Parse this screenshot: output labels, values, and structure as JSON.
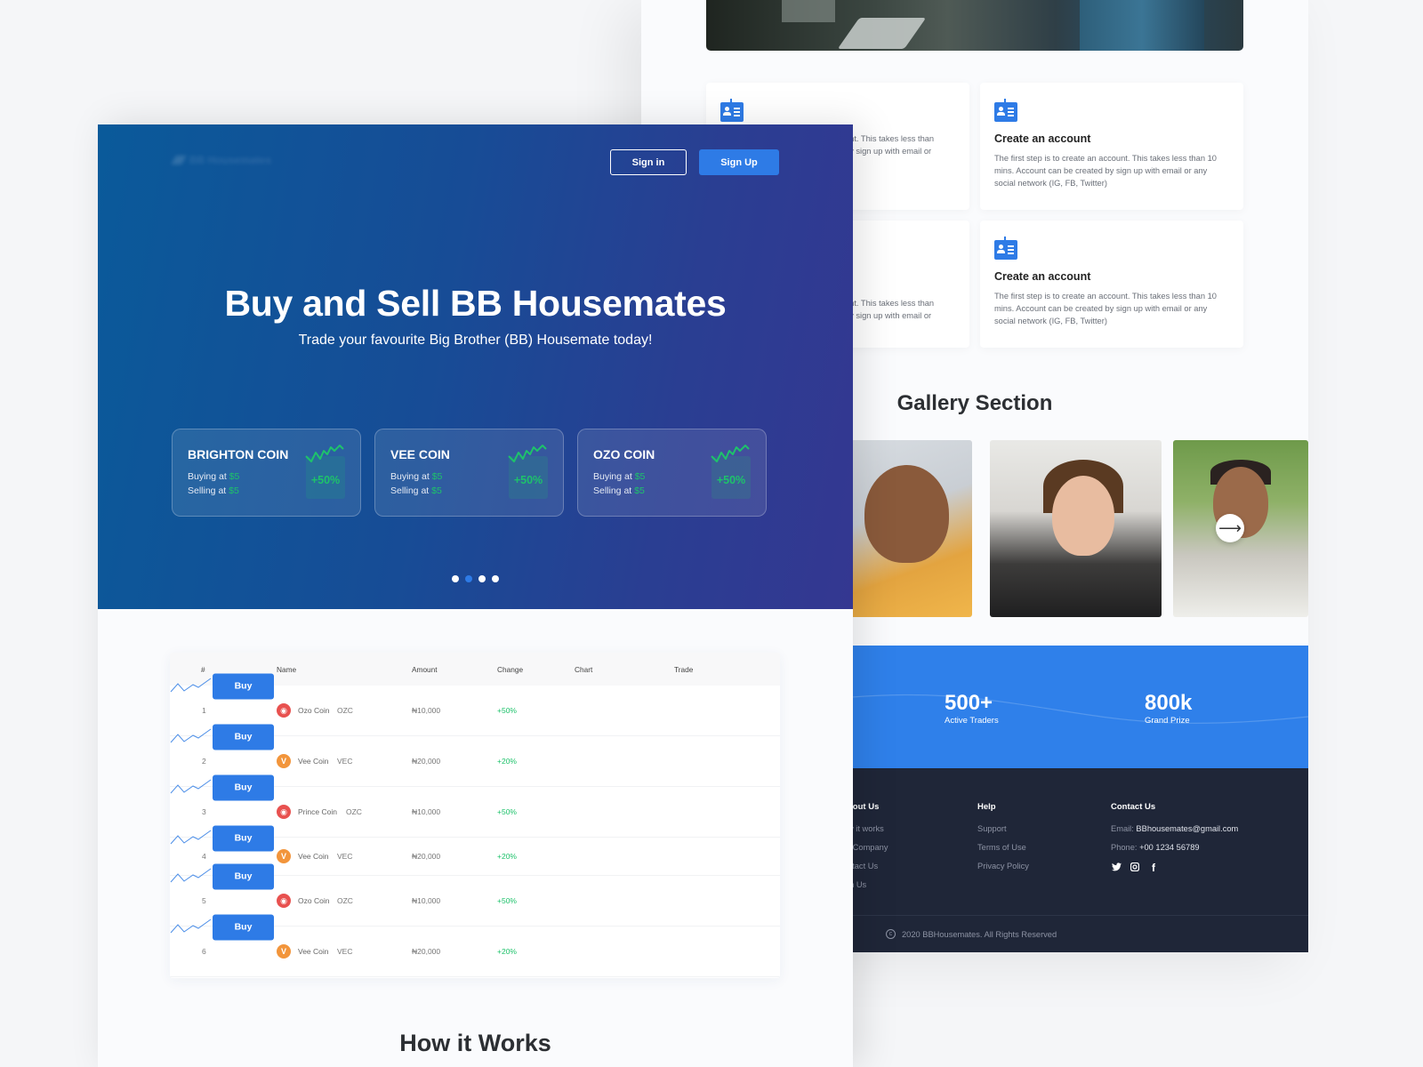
{
  "back_page": {
    "steps": [
      {
        "title": "",
        "text": "unt. This takes less than\nby sign up with email or\n)"
      },
      {
        "title": "Create an account",
        "text": "The first step is to create an account. This takes less than 10 mins. Account can be created by sign up with email or any social network (IG, FB, Twitter)"
      },
      {
        "title": "",
        "text": "unt. This takes less than\nby sign up with email or\n)"
      },
      {
        "title": "Create an account",
        "text": "The first step is to create an account. This takes less than 10 mins. Account can be created by sign up with email or any social network (IG, FB, Twitter)"
      }
    ],
    "gallery": {
      "title": "Gallery Section",
      "next_icon": "arrow-right-icon",
      "next_glyph": "⟶"
    },
    "stats": [
      {
        "value": "500+",
        "label": "Active Traders"
      },
      {
        "value": "800k",
        "label": "Grand Prize"
      }
    ],
    "footer": {
      "about": {
        "heading": "bout Us",
        "links": [
          "w it works",
          "r Company",
          "ntact Us",
          "in Us"
        ]
      },
      "help": {
        "heading": "Help",
        "links": [
          "Support",
          "Terms of Use",
          "Privacy Policy"
        ]
      },
      "contact": {
        "heading": "Contact Us",
        "email_label": "Email: ",
        "email": "BBhousemates@gmail.com",
        "phone_label": "Phone: ",
        "phone": "+00 1234 56789",
        "socials": [
          {
            "name": "twitter-icon",
            "glyph": "🐦︎"
          },
          {
            "name": "instagram-icon",
            "glyph": "◎"
          },
          {
            "name": "facebook-icon",
            "glyph": "f"
          }
        ]
      },
      "copyright_glyph": "c",
      "copyright": "2020 BBHousemates. All Rights Reserved"
    }
  },
  "front_page": {
    "logo": "BB Housemates",
    "nav": {
      "sign_in": "Sign in",
      "sign_up": "Sign Up"
    },
    "hero": {
      "title": "Buy and Sell BB Housemates",
      "subtitle": "Trade your favourite Big Brother (BB) Housemate today!"
    },
    "coins": [
      {
        "name": "BRIGHTON COIN",
        "buy_label": "Buying at ",
        "buy_price": "$5",
        "sell_label": "Selling at ",
        "sell_price": "$5",
        "change": "+50%"
      },
      {
        "name": "VEE COIN",
        "buy_label": "Buying at ",
        "buy_price": "$5",
        "sell_label": "Selling at ",
        "sell_price": "$5",
        "change": "+50%"
      },
      {
        "name": "OZO COIN",
        "buy_label": "Buying at ",
        "buy_price": "$5",
        "sell_label": "Selling at ",
        "sell_price": "$5",
        "change": "+50%"
      }
    ],
    "carousel": {
      "count": 4,
      "active_index": 1
    },
    "table": {
      "headers": [
        "#",
        "Name",
        "Amount",
        "Change",
        "Chart",
        "Trade"
      ],
      "rows": [
        {
          "num": "1",
          "icon": "red",
          "glyph": "◉",
          "name": "Ozo Coin",
          "symbol": "OZC",
          "amount": "₦10,000",
          "change": "+50%",
          "action": "Buy"
        },
        {
          "num": "2",
          "icon": "orange",
          "glyph": "V",
          "name": "Vee Coin",
          "symbol": "VEC",
          "amount": "₦20,000",
          "change": "+20%",
          "action": "Buy"
        },
        {
          "num": "3",
          "icon": "red",
          "glyph": "◉",
          "name": "Prince Coin",
          "symbol": "OZC",
          "amount": "₦10,000",
          "change": "+50%",
          "action": "Buy"
        },
        {
          "num": "4",
          "icon": "orange",
          "glyph": "V",
          "name": "Vee Coin",
          "symbol": "VEC",
          "amount": "₦20,000",
          "change": "+20%",
          "action": "Buy"
        },
        {
          "num": "5",
          "icon": "red",
          "glyph": "◉",
          "name": "Ozo Coin",
          "symbol": "OZC",
          "amount": "₦10,000",
          "change": "+50%",
          "action": "Buy"
        },
        {
          "num": "6",
          "icon": "orange",
          "glyph": "V",
          "name": "Vee Coin",
          "symbol": "VEC",
          "amount": "₦20,000",
          "change": "+20%",
          "action": "Buy"
        }
      ]
    },
    "how_it_works_title": "How it Works"
  },
  "colors": {
    "accent": "#2e7be6",
    "positive": "#1ec26b",
    "hero_start": "#0a5a9a",
    "hero_end": "#343791",
    "footer_bg": "#1f2638"
  }
}
